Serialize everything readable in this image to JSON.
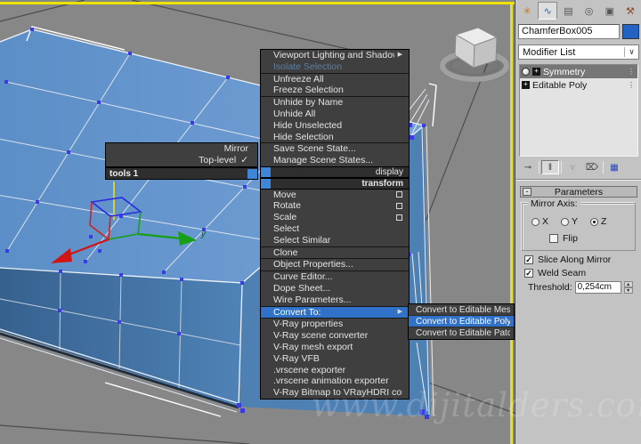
{
  "watermark": "www.dijitalders.com",
  "icons": {
    "submenu_arrow": "▶",
    "check": "✓",
    "dropdown_arrow": "∨",
    "plus": "+",
    "minus": "-",
    "spinner_up": "▴",
    "spinner_down": "▾",
    "dots": "⋮"
  },
  "viewport": {
    "gizmo_y_label": "y"
  },
  "left_quad": {
    "title": "tools 1",
    "items": [
      {
        "label": "Mirror"
      },
      {
        "label": "Top-level",
        "checked": true
      }
    ]
  },
  "menu": {
    "items": [
      {
        "label": "Viewport Lighting and Shadows"
      },
      {
        "label": "Isolate Selection"
      },
      {
        "label": "Unfreeze All"
      },
      {
        "label": "Freeze Selection"
      },
      {
        "label": "Unhide by Name"
      },
      {
        "label": "Unhide All"
      },
      {
        "label": "Hide Unselected"
      },
      {
        "label": "Hide Selection"
      },
      {
        "label": "Save Scene State..."
      },
      {
        "label": "Manage Scene States..."
      },
      {
        "label": "display"
      },
      {
        "label": "transform"
      },
      {
        "label": "Move"
      },
      {
        "label": "Rotate"
      },
      {
        "label": "Scale"
      },
      {
        "label": "Select"
      },
      {
        "label": "Select Similar"
      },
      {
        "label": "Clone"
      },
      {
        "label": "Object Properties..."
      },
      {
        "label": "Curve Editor..."
      },
      {
        "label": "Dope Sheet..."
      },
      {
        "label": "Wire Parameters..."
      },
      {
        "label": "Convert To:"
      },
      {
        "label": "V-Ray properties"
      },
      {
        "label": "V-Ray scene converter"
      },
      {
        "label": "V-Ray mesh export"
      },
      {
        "label": "V-Ray VFB"
      },
      {
        "label": ".vrscene exporter"
      },
      {
        "label": ".vrscene animation exporter"
      },
      {
        "label": "V-Ray Bitmap to VRayHDRI converter"
      }
    ]
  },
  "submenu": {
    "highlighted": "Convert to Editable Poly",
    "items": [
      {
        "label": "Convert to Editable Mesh"
      },
      {
        "label": "Convert to Editable Poly"
      },
      {
        "label": "Convert to Editable Patch"
      }
    ]
  },
  "panel": {
    "tabs": [
      {
        "name": "create",
        "glyph": "✳"
      },
      {
        "name": "modify",
        "glyph": "∿",
        "active": true
      },
      {
        "name": "hierarchy",
        "glyph": "▤"
      },
      {
        "name": "motion",
        "glyph": "◎"
      },
      {
        "name": "display",
        "glyph": "▣"
      },
      {
        "name": "utilities",
        "glyph": "⚒"
      }
    ],
    "object_name": "ChamferBox005",
    "object_color": "#2263c2",
    "modifier_list_label": "Modifier List",
    "stack": [
      {
        "label": "Symmetry",
        "selected": true
      },
      {
        "label": "Editable Poly"
      }
    ],
    "stack_buttons": [
      {
        "name": "pin-stack",
        "glyph": "⊸"
      },
      {
        "name": "show-end-result",
        "glyph": "‖"
      },
      {
        "name": "make-unique",
        "glyph": "⋎"
      },
      {
        "name": "remove-modifier",
        "glyph": "⌦"
      },
      {
        "name": "configure-modifier-sets",
        "glyph": "▦"
      }
    ],
    "parameters": {
      "title": "Parameters",
      "mirror_axis_label": "Mirror Axis:",
      "axis_options": [
        {
          "label": "X",
          "selected": false
        },
        {
          "label": "Y",
          "selected": false
        },
        {
          "label": "Z",
          "selected": true
        }
      ],
      "flip_label": "Flip",
      "flip_checked": false,
      "slice_label": "Slice Along Mirror",
      "slice_checked": true,
      "weld_label": "Weld Seam",
      "weld_checked": true,
      "threshold_label": "Threshold:",
      "threshold_value": "0,254cm"
    }
  }
}
